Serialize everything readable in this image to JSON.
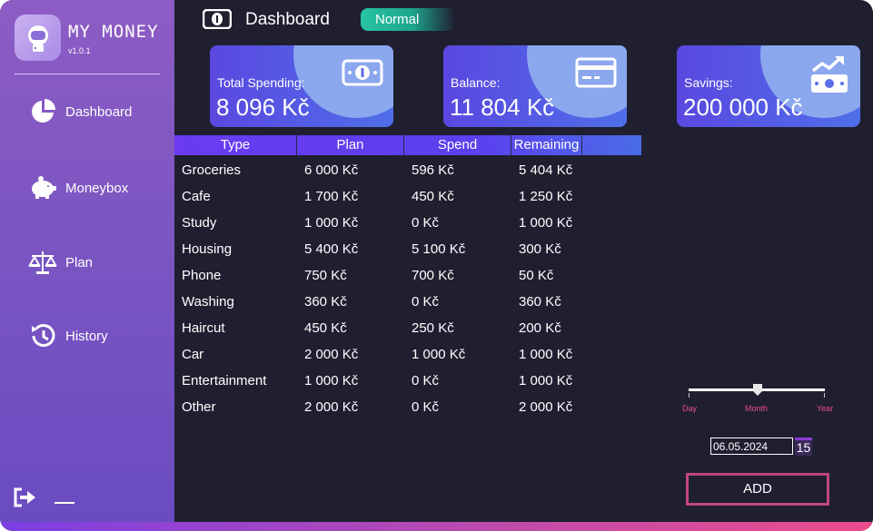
{
  "app": {
    "name": "MY MONEY",
    "version": "v1.0.1"
  },
  "sidebar": {
    "items": [
      {
        "label": "Dashboard",
        "icon": "pie-chart-icon"
      },
      {
        "label": "Moneybox",
        "icon": "piggy-bank-icon"
      },
      {
        "label": "Plan",
        "icon": "scales-icon"
      },
      {
        "label": "History",
        "icon": "history-icon"
      }
    ]
  },
  "header": {
    "title": "Dashboard",
    "mode": "Normal"
  },
  "cards": [
    {
      "label": "Total Spending:",
      "value": "8 096 Kč",
      "icon": "banknote-icon"
    },
    {
      "label": "Balance:",
      "value": "11 804 Kč",
      "icon": "credit-card-icon"
    },
    {
      "label": "Savings:",
      "value": "200 000 Kč",
      "icon": "money-growth-icon"
    }
  ],
  "table": {
    "headers": [
      "Type",
      "Plan",
      "Spend",
      "Remaining"
    ],
    "rows": [
      [
        "Groceries",
        "6 000 Kč",
        "596 Kč",
        "5 404 Kč"
      ],
      [
        "Cafe",
        "1 700 Kč",
        "450 Kč",
        "1 250 Kč"
      ],
      [
        "Study",
        "1 000 Kč",
        "0 Kč",
        "1 000 Kč"
      ],
      [
        "Housing",
        "5 400 Kč",
        "5 100 Kč",
        "300 Kč"
      ],
      [
        "Phone",
        "750 Kč",
        "700 Kč",
        "50 Kč"
      ],
      [
        "Washing",
        "360 Kč",
        "0 Kč",
        "360 Kč"
      ],
      [
        "Haircut",
        "450 Kč",
        "250 Kč",
        "200 Kč"
      ],
      [
        "Car",
        "2 000 Kč",
        "1 000 Kč",
        "1 000 Kč"
      ],
      [
        "Entertainment",
        "1 000 Kč",
        "0 Kč",
        "1 000 Kč"
      ],
      [
        "Other",
        "2 000 Kč",
        "0 Kč",
        "2 000 Kč"
      ]
    ]
  },
  "period_slider": {
    "labels": [
      "Day",
      "Month",
      "Year"
    ],
    "selected": "Month"
  },
  "date_picker": {
    "value": "06.05.2024",
    "calendar_day": "15"
  },
  "add_button": {
    "label": "ADD"
  },
  "colors": {
    "background": "#1f1f30",
    "sidebar": "#7a55c2",
    "accent_teal": "#27c4a3",
    "accent_pink": "#ec4c8c",
    "card": "#5a48e0"
  }
}
